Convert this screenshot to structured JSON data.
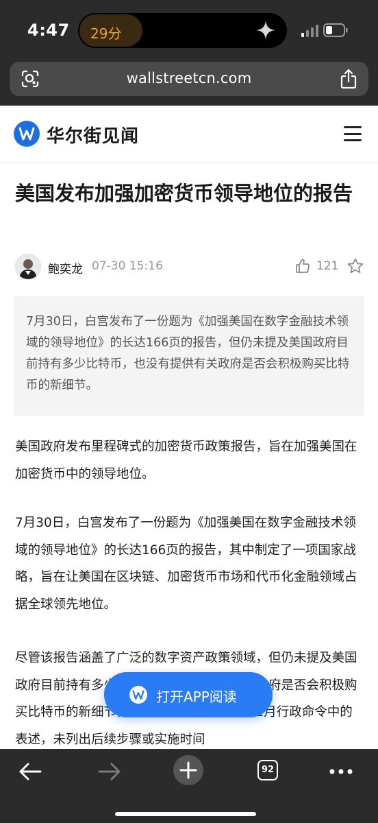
{
  "status_bar": {
    "time": "4:47",
    "island_timer": "29分"
  },
  "browser": {
    "url": "wallstreetcn.com",
    "tab_count": "92"
  },
  "site": {
    "name": "华尔街见闻"
  },
  "article": {
    "title": "美国发布加强加密货币领导地位的报告",
    "author": "鲍奕龙",
    "date": "07-30 15:16",
    "likes": "121",
    "summary": "7月30日，白宫发布了一份题为《加强美国在数字金融技术领域的领导地位》的长达166页的报告，但仍未提及美国政府目前持有多少比特币，也没有提供有关政府是否会积极购买比特币的新细节。",
    "paragraphs": [
      "美国政府发布里程碑式的加密货币政策报告，旨在加强美国在加密货币中的领导地位。",
      "7月30日，白宫发布了一份题为《加强美国在数字金融技术领域的领导地位》的长达166页的报告，其中制定了一项国家战略，旨在让美国在区块链、加密货币市场和代币化金融领域占据全球领先地位。",
      "尽管该报告涵盖了广泛的数字资产政策领域，但仍未提及美国政府目前持有多少比特币，也没有提供有关政府是否会积极购买比特币的新细节，只是重申了特朗普总统1月行政命令中的表述，未列出后续步骤或实施时间"
    ]
  },
  "cta": {
    "label": "打开APP阅读"
  },
  "colors": {
    "brand_blue": "#2a7cf6",
    "logo_blue": "#1d6fe0",
    "chrome_dark": "#2b2b2b",
    "timer_orange": "#f5a524"
  },
  "icons": [
    "lens-icon",
    "share-icon",
    "menu-icon",
    "like-icon",
    "star-icon",
    "back-icon",
    "forward-icon",
    "new-tab-icon",
    "tabs-icon",
    "more-icon"
  ]
}
